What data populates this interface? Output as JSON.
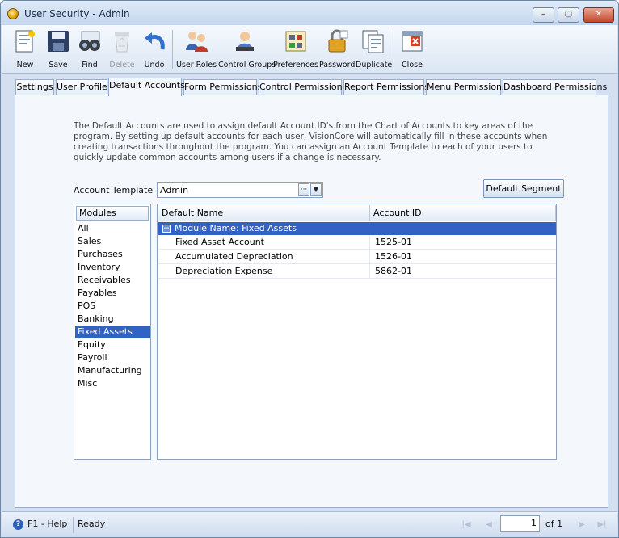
{
  "window": {
    "title": "User Security - Admin",
    "minimize_glyph": "–",
    "maximize_glyph": "▢",
    "close_glyph": "✕"
  },
  "toolbar": {
    "items": [
      {
        "label": "New",
        "icon": "new-document-icon",
        "enabled": true
      },
      {
        "label": "Save",
        "icon": "floppy-disk-icon",
        "enabled": true
      },
      {
        "label": "Find",
        "icon": "binoculars-icon",
        "enabled": true
      },
      {
        "label": "Delete",
        "icon": "recycle-bin-icon",
        "enabled": false
      },
      {
        "label": "Undo",
        "icon": "undo-arrow-icon",
        "enabled": true
      },
      {
        "label": "User Roles",
        "icon": "user-roles-icon",
        "enabled": true
      },
      {
        "label": "Control Groups",
        "icon": "control-groups-icon",
        "enabled": true
      },
      {
        "label": "Preferences",
        "icon": "preferences-icon",
        "enabled": true
      },
      {
        "label": "Password",
        "icon": "password-lock-icon",
        "enabled": true
      },
      {
        "label": "Duplicate",
        "icon": "duplicate-icon",
        "enabled": true
      },
      {
        "label": "Close",
        "icon": "close-window-icon",
        "enabled": true
      }
    ]
  },
  "tabs": [
    {
      "label": "Settings"
    },
    {
      "label": "User Profile"
    },
    {
      "label": "Default Accounts",
      "active": true
    },
    {
      "label": "Form Permissions"
    },
    {
      "label": "Control Permissions"
    },
    {
      "label": "Report Permissions"
    },
    {
      "label": "Menu Permissions"
    },
    {
      "label": "Dashboard Permissions"
    }
  ],
  "default_accounts": {
    "description": "The Default Accounts are used to assign default Account ID's from the Chart of Accounts to key areas of the program.  By setting up default accounts for each user, VisionCore will automatically fill in these accounts when creating transactions throughout the program.  You can assign an Account Template to each of your users to quickly update common accounts among users if a change is necessary.",
    "account_template_label": "Account Template",
    "account_template_value": "Admin",
    "ellipsis_glyph": "···",
    "dropdown_glyph": "▼",
    "default_segment_label": "Default Segment",
    "modules_header": "Modules",
    "modules": [
      "All",
      "Sales",
      "Purchases",
      "Inventory",
      "Receivables",
      "Payables",
      "POS",
      "Banking",
      "Fixed Assets",
      "Equity",
      "Payroll",
      "Manufacturing",
      "Misc"
    ],
    "selected_module": "Fixed Assets",
    "grid": {
      "columns": [
        "Default Name",
        "Account ID"
      ],
      "group_label": "Module Name: Fixed Assets",
      "group_expander": "−",
      "rows": [
        {
          "name": "Fixed Asset Account",
          "account_id": "1525-01"
        },
        {
          "name": "Accumulated Depreciation",
          "account_id": "1526-01"
        },
        {
          "name": "Depreciation Expense",
          "account_id": "5862-01"
        }
      ]
    }
  },
  "statusbar": {
    "help_glyph": "?",
    "help_label": "F1 - Help",
    "status_text": "Ready",
    "page_current": "1",
    "page_of": "of 1",
    "nav_first": "|◀",
    "nav_prev": "◀",
    "nav_next": "▶",
    "nav_last": "▶|"
  },
  "colors": {
    "accent": "#3162c4",
    "window_bg": "#d4e0f0",
    "panel_bg": "#f4f7fb"
  }
}
